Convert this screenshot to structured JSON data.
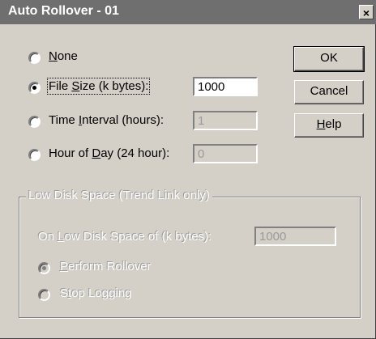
{
  "window": {
    "title": "Auto Rollover - 01",
    "close_label": "×"
  },
  "options": {
    "none": {
      "pre": "",
      "key": "N",
      "post": "one"
    },
    "file_size": {
      "pre": "File ",
      "key": "S",
      "post": "ize (k bytes):",
      "value": "1000"
    },
    "time_interval": {
      "pre": "Time ",
      "key": "I",
      "post": "nterval (hours):",
      "value": "1"
    },
    "hour_of_day": {
      "pre": "Hour of ",
      "key": "D",
      "post": "ay (24 hour):",
      "value": "0"
    }
  },
  "buttons": {
    "ok": "OK",
    "cancel": "Cancel",
    "help": {
      "key": "H",
      "post": "elp"
    }
  },
  "low_disk": {
    "legend": "Low Disk Space (Trend Link only)",
    "threshold": {
      "pre": "On ",
      "key": "L",
      "post": "ow Disk Space of (k bytes):",
      "value": "1000"
    },
    "perform_rollover": {
      "key": "P",
      "post": "erform Rollover"
    },
    "stop_logging": {
      "pre": "S",
      "key": "t",
      "post": "op Logging"
    }
  }
}
